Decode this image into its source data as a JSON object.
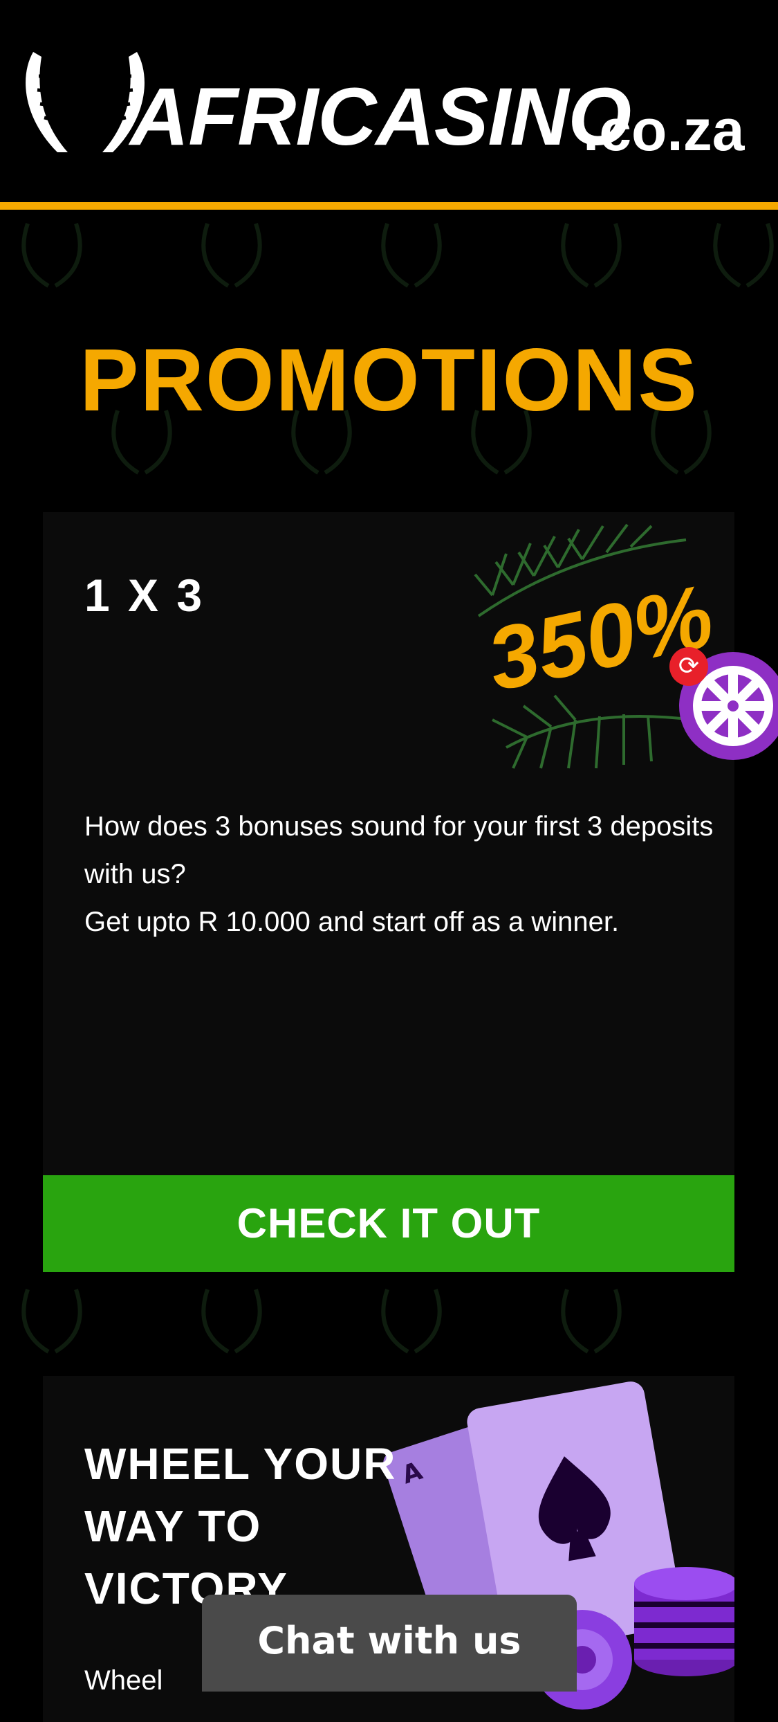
{
  "header": {
    "brand_name": "AFRICASINO",
    "brand_tld": ".co.za",
    "accent_color": "#f5a800"
  },
  "page": {
    "title": "PROMOTIONS"
  },
  "promotions": [
    {
      "title": "1 X 3",
      "art_text": "350%",
      "description_lines": [
        "How does 3 bonuses sound for your first 3 deposits with us?",
        "Get upto R 10.000 and start off as a winner."
      ],
      "cta_label": "CHECK IT OUT"
    },
    {
      "title": "WHEEL YOUR WAY TO VICTORY",
      "description_partial": "Wheel"
    }
  ],
  "widgets": {
    "wheel_icon": "wheel-of-fortune-icon",
    "refresh_icon": "refresh-icon",
    "refresh_glyph": "⟳"
  },
  "chat": {
    "label": "Chat with us"
  },
  "colors": {
    "background": "#000000",
    "card_background": "#0b0b0b",
    "cta_green": "#29a40f",
    "title_orange": "#f5a800",
    "widget_purple": "#8e2fc4",
    "badge_red": "#e8202a",
    "chat_gray": "#4a4a4a"
  }
}
